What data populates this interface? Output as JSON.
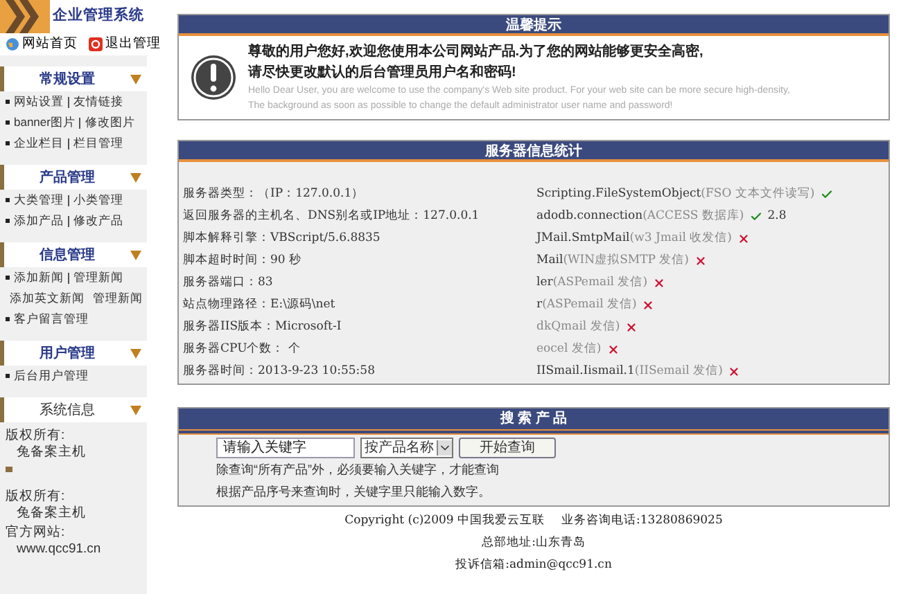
{
  "sidebar": {
    "logo_title": "企业管理系统",
    "top_links": [
      {
        "label": "网站首页",
        "kind": "home"
      },
      {
        "label": "退出管理",
        "kind": "logout"
      }
    ],
    "sections": [
      {
        "title": "常规设置",
        "bold": true,
        "rows": [
          [
            "网站设置",
            "友情链接"
          ],
          [
            "banner图片",
            "修改图片"
          ],
          [
            "企业栏目",
            "栏目管理"
          ]
        ]
      },
      {
        "title": "产品管理",
        "bold": true,
        "rows": [
          [
            "大类管理",
            "小类管理"
          ],
          [
            "添加产品",
            "修改产品"
          ]
        ]
      },
      {
        "title": "信息管理",
        "bold": true,
        "rows": [
          [
            "添加新闻",
            "管理新闻"
          ],
          [
            "添加英文新闻",
            "管理新闻"
          ],
          [
            "客户留言管理"
          ]
        ]
      },
      {
        "title": "用户管理",
        "bold": true,
        "rows": [
          [
            "后台用户管理"
          ]
        ]
      },
      {
        "title": "系统信息",
        "bold": false
      }
    ],
    "info_1": [
      "版权所有:",
      "兔备案主机"
    ],
    "info_2": [
      "版权所有:",
      "兔备案主机",
      "官方网站:",
      "www.qcc91.cn"
    ]
  },
  "notice": {
    "title": "温馨提示",
    "lines_cn": [
      "尊敬的用户您好,欢迎您使用本公司网站产品.为了您的网站能够更安全高密,",
      "请尽快更改默认的后台管理员用户名和密码!"
    ],
    "lines_en": [
      "Hello Dear User, you are welcome to use the company's Web site product. For your web site can be more secure high-density,",
      "The background as soon as possible to change the default administrator user name and password!"
    ]
  },
  "server": {
    "title": "服务器信息统计",
    "left": [
      "服务器类型：（IP：127.0.0.1）",
      "返回服务器的主机名、DNS别名或IP地址：127.0.0.1",
      "脚本解释引擎：VBScript/5.6.8835",
      "脚本超时时间：90 秒",
      "服务器端口：83",
      "站点物理路径：E:\\源码\\net",
      "服务器IIS版本：Microsoft-I",
      "服务器CPU个数： 个",
      "服务器时间：2013-9-23 10:55:58"
    ],
    "right": [
      {
        "name": "Scripting.FileSystemObject",
        "desc": "(FSO 文本文件读写)",
        "supported": true
      },
      {
        "name": "adodb.connection",
        "desc": "(ACCESS 数据库)",
        "supported": true,
        "version": "2.8"
      },
      {
        "name": "JMail.SmtpMail",
        "desc": "(w3 Jmail 收发信)",
        "supported": false
      },
      {
        "name": "Mail",
        "desc": "(WIN虚拟SMTP 发信)",
        "supported": false
      },
      {
        "name": "ler",
        "desc": "(ASPemail 发信)",
        "supported": false
      },
      {
        "name": "r",
        "desc": "(ASPemail 发信)",
        "supported": false
      },
      {
        "desc": "dkQmail 发信)",
        "supported": false
      },
      {
        "desc": "eocel 发信)",
        "supported": false
      },
      {
        "name": "IISmail.Iismail.1",
        "desc": "(IISemail 发信)",
        "supported": false
      }
    ]
  },
  "search": {
    "title": "搜 索 产 品",
    "keyword": "请输入关键字",
    "select": "按产品名称",
    "button": "开始查询",
    "hints": [
      "除查询“所有产品”外，必须要输入关键字，才能查询",
      "根据产品序号来查询时，关键字里只能输入数字。"
    ]
  },
  "footer": [
    "Copyright (c)2009 中国我爱云互联",
    "业务咨询电话:13280869025",
    "总部地址:山东青岛",
    "投诉信箱:admin@qcc91.cn"
  ]
}
